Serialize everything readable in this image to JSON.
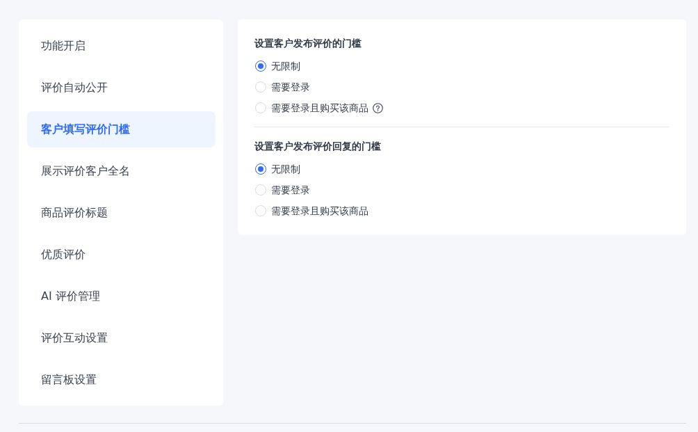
{
  "sidebar": {
    "items": [
      {
        "label": "功能开启",
        "selected": false
      },
      {
        "label": "评价自动公开",
        "selected": false
      },
      {
        "label": "客户填写评价门槛",
        "selected": true
      },
      {
        "label": "展示评价客户全名",
        "selected": false
      },
      {
        "label": "商品评价标题",
        "selected": false
      },
      {
        "label": "优质评价",
        "selected": false
      },
      {
        "label": "AI 评价管理",
        "selected": false
      },
      {
        "label": "评价互动设置",
        "selected": false
      },
      {
        "label": "留言板设置",
        "selected": false
      }
    ]
  },
  "sections": [
    {
      "title": "设置客户发布评价的门槛",
      "options": [
        {
          "label": "无限制",
          "selected": true,
          "help_icon": false
        },
        {
          "label": "需要登录",
          "selected": false,
          "help_icon": false
        },
        {
          "label": "需要登录且购买该商品",
          "selected": false,
          "help_icon": true
        }
      ]
    },
    {
      "title": "设置客户发布评价回复的门槛",
      "options": [
        {
          "label": "无限制",
          "selected": true,
          "help_icon": false
        },
        {
          "label": "需要登录",
          "selected": false,
          "help_icon": false
        },
        {
          "label": "需要登录且购买该商品",
          "selected": false,
          "help_icon": false
        }
      ]
    }
  ]
}
